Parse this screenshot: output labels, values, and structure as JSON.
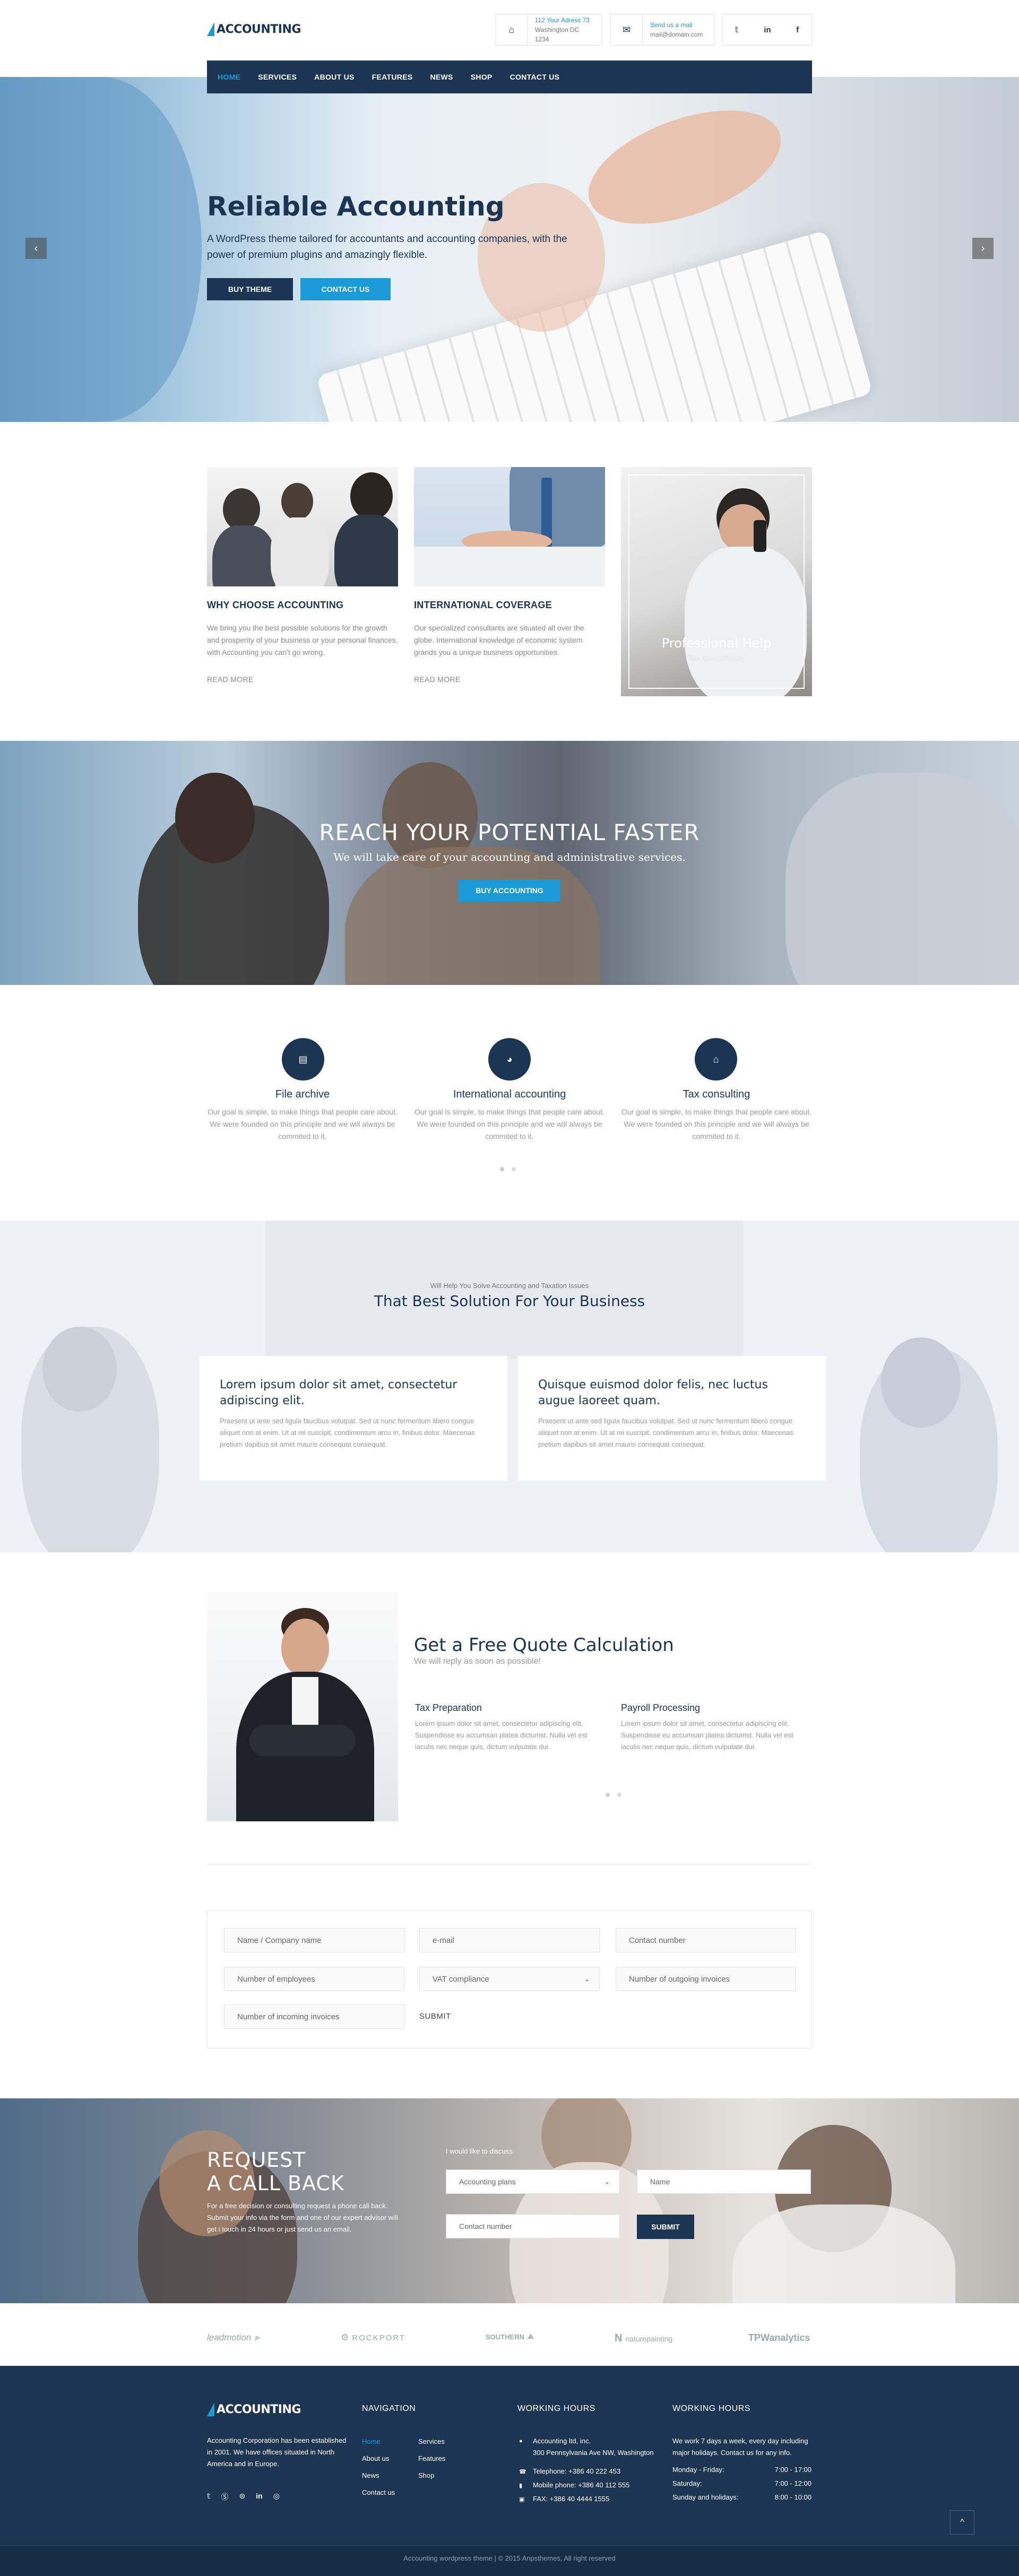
{
  "brand": {
    "logo_text": "ACCOUNTING",
    "accent": "#1a9bd7",
    "navy": "#1c3552"
  },
  "header": {
    "address": {
      "line1": "112 Your Adress 73",
      "line2": "Washington DC 1234",
      "icon": "home-icon"
    },
    "email": {
      "line1": "Send us a mail",
      "line2": "mail@domain.com",
      "icon": "envelope-icon"
    },
    "social": [
      "twitter-icon",
      "linkedin-icon",
      "facebook-icon"
    ]
  },
  "nav": {
    "items": [
      "HOME",
      "SERVICES",
      "ABOUT US",
      "FEATURES",
      "NEWS",
      "SHOP",
      "CONTACT US"
    ],
    "active": "HOME"
  },
  "hero": {
    "title": "Reliable Accounting",
    "subtitle": "A WordPress theme tailored for accountants and accounting companies, with the power of premium plugins and amazingly flexible.",
    "btn_primary": "BUY THEME",
    "btn_secondary": "CONTACT US",
    "prev": "‹",
    "next": "›"
  },
  "features": [
    {
      "title": "WHY CHOOSE ACCOUNTING",
      "text": "We bring you the best possible solutions for the growth and prosperity of your business or your personal finances, with Accounting you can't go wrong.",
      "more": "READ MORE"
    },
    {
      "title": "INTERNATIONAL COVERAGE",
      "text": "Our specialized consultants are situated all over the globe. International knowledge of economic system grands you a unique business opportunities.",
      "more": "READ MORE"
    },
    {
      "title": "Professional Help",
      "subtitle": "Tax Consultation"
    }
  ],
  "potential": {
    "title": "REACH YOUR POTENTIAL FASTER",
    "subtitle": "We will take care of your accounting and administrative services.",
    "button": "BUY ACCOUNTING"
  },
  "services": [
    {
      "title": "File archive",
      "icon": "archive-icon",
      "text": "Our goal is simple, to make things that people care about. We were founded on this principle and we will always be commited to it."
    },
    {
      "title": "International accounting",
      "icon": "globe-icon",
      "text": "Our goal is simple, to make things that people care about. We were founded on this principle and we will always be commited to it."
    },
    {
      "title": "Tax consulting",
      "icon": "bank-icon",
      "text": "Our goal is simple, to make things that people care about. We were founded on this principle and we will always be commited to it."
    }
  ],
  "solution": {
    "pretitle": "Will Help You Solve Accounting and Taxation Issues",
    "title": "That Best Solution For Your Business",
    "cards": [
      {
        "title": "Lorem ipsum dolor sit amet, consectetur adipiscing elit.",
        "text": "Praesent ut ante sed ligula faucibus volutpat. Sed ut nunc fermentum libero congue aliquet non at enim. Ut at mi suscipit, condimentum arcu in, finibus dolor. Maecenas pretium dapibus sit amet mauris consequat consequat."
      },
      {
        "title": "Quisque euismod dolor felis, nec luctus augue laoreet quam.",
        "text": "Praesent ut ante sed ligula faucibus volutpat. Sed ut nunc fermentum libero congue aliquet non at enim. Ut at mi suscipit, condimentum arcu in, finibus dolor. Maecenas pretium dapibus sit amet mauris consequat consequat."
      }
    ]
  },
  "quote": {
    "title": "Get a Free Quote Calculation",
    "subtitle": "We will reply as soon as possible!",
    "cols": [
      {
        "title": "Tax Preparation",
        "text": "Lorem ipsum dolor sit amet, consectetur adipiscing elit. Suspendisse eu accumsan platea dictumst. Nulla vel est iaculis nec neque quis, dictum vulputate dui."
      },
      {
        "title": "Payroll Processing",
        "text": "Lorem ipsum dolor sit amet, consectetur adipiscing elit. Suspendisse eu accumsan platea dictumst. Nulla vel est iaculis nec neque quis, dictum vulputate dui."
      }
    ],
    "form": {
      "f1": "Name / Company name",
      "f2": "e-mail",
      "f3": "Contact number",
      "f4": "Number of employees",
      "f5": "VAT compliance",
      "f6": "Number of outgoing invoices",
      "f7": "Number of incoming invoices",
      "submit": "SUBMIT"
    }
  },
  "callback": {
    "title_line1": "REQUEST",
    "title_line2": "A CALL BACK",
    "text": "For a free decision or consulting request a phone call back. Submit your info via the form and one of our expert advisor will get i touch in 24 hours or just send us an email.",
    "label": "I would like to discuss:",
    "select": "Accounting plans",
    "name": "Name",
    "contact": "Contact number",
    "submit": "SUBMIT"
  },
  "partners": [
    "leadmotion",
    "ROCKPORT",
    "SOUTHERN",
    "naturepainting",
    "TPWanalytics"
  ],
  "footer": {
    "about": "Accounting Corporation has been established in 2001. We have offices situated in North America and in Europe.",
    "social": [
      "twitter-icon",
      "skype-icon",
      "skype-icon",
      "linkedin-icon",
      "dribbble-icon"
    ],
    "nav_heading": "NAVIGATION",
    "nav_col1": [
      "Home",
      "About us",
      "News",
      "Contact us"
    ],
    "nav_col2": [
      "Services",
      "Features",
      "Shop"
    ],
    "contact_heading": "WORKING HOURS",
    "contact": [
      {
        "icon": "pin-icon",
        "text": "Accounting ltd, inc.",
        "text2": "300 Pennsylvania Ave NW, Washington"
      },
      {
        "icon": "phone-icon",
        "text": "Telephone: +386 40 222 453"
      },
      {
        "icon": "mobile-icon",
        "text": "Mobile phone: +386 40 112 555"
      },
      {
        "icon": "fax-icon",
        "text": "FAX: +386 40 4444 1555"
      }
    ],
    "hours_heading": "WORKING HOURS",
    "hours_text": "We work 7 days a week, every day including major holidays. Contact us for any info.",
    "hours": [
      {
        "day": "Monday - Friday:",
        "time": "7:00 - 17:00"
      },
      {
        "day": "Saturday:",
        "time": "7:00 - 12:00"
      },
      {
        "day": "Sunday and holidays:",
        "time": "8:00 - 10:00"
      }
    ],
    "copyright": "Accounting wordpress theme | © 2015 Anpsthemes, All right reserved",
    "totop": "^"
  }
}
